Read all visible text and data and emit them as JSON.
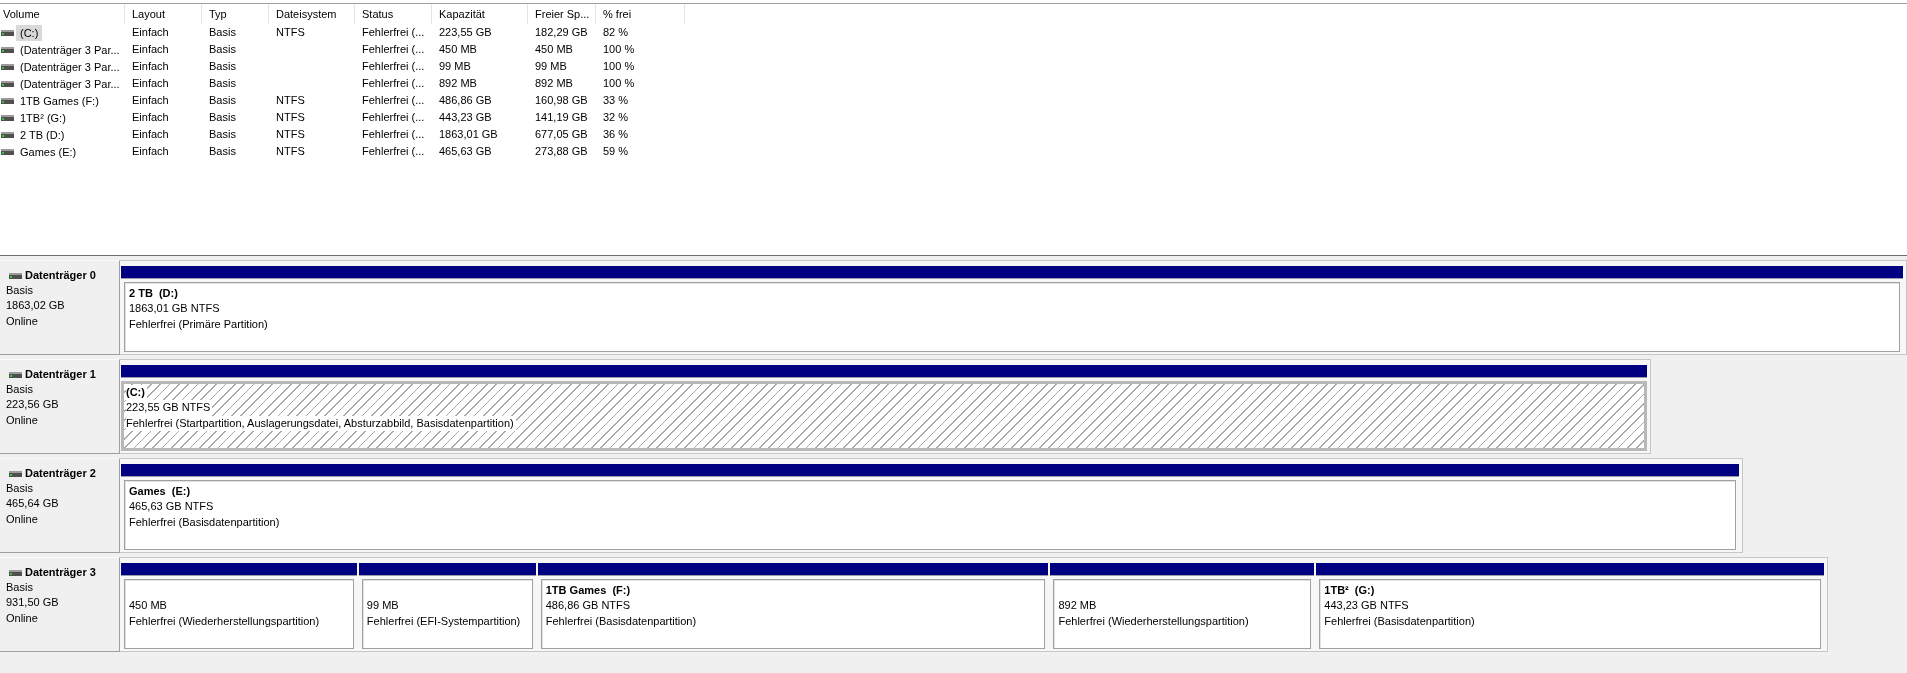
{
  "volume_table": {
    "columns": [
      "Volume",
      "Layout",
      "Typ",
      "Dateisystem",
      "Status",
      "Kapazität",
      "Freier Sp...",
      "% frei"
    ],
    "rows": [
      {
        "volume": "(C:)",
        "layout": "Einfach",
        "type": "Basis",
        "file_system": "NTFS",
        "status": "Fehlerfrei (...",
        "capacity": "223,55 GB",
        "free_space": "182,29 GB",
        "percent_free": "82 %",
        "selected": true
      },
      {
        "volume": "(Datenträger 3 Par...",
        "layout": "Einfach",
        "type": "Basis",
        "status": "Fehlerfrei (...",
        "capacity": "450 MB",
        "free_space": "450 MB",
        "percent_free": "100 %",
        "selected": false
      },
      {
        "volume": "(Datenträger 3 Par...",
        "layout": "Einfach",
        "type": "Basis",
        "status": "Fehlerfrei (...",
        "capacity": "99 MB",
        "free_space": "99 MB",
        "percent_free": "100 %",
        "selected": false
      },
      {
        "volume": "(Datenträger 3 Par...",
        "layout": "Einfach",
        "type": "Basis",
        "status": "Fehlerfrei (...",
        "capacity": "892 MB",
        "free_space": "892 MB",
        "percent_free": "100 %",
        "selected": false
      },
      {
        "volume": "1TB Games (F:)",
        "layout": "Einfach",
        "type": "Basis",
        "file_system": "NTFS",
        "status": "Fehlerfrei (...",
        "capacity": "486,86 GB",
        "free_space": "160,98 GB",
        "percent_free": "33 %",
        "selected": false
      },
      {
        "volume": "1TB² (G:)",
        "layout": "Einfach",
        "type": "Basis",
        "file_system": "NTFS",
        "status": "Fehlerfrei (...",
        "capacity": "443,23 GB",
        "free_space": "141,19 GB",
        "percent_free": "32 %",
        "selected": false
      },
      {
        "volume": "2 TB (D:)",
        "layout": "Einfach",
        "type": "Basis",
        "file_system": "NTFS",
        "status": "Fehlerfrei (...",
        "capacity": "1863,01 GB",
        "free_space": "677,05 GB",
        "percent_free": "36 %",
        "selected": false
      },
      {
        "volume": "Games (E:)",
        "layout": "Einfach",
        "type": "Basis",
        "file_system": "NTFS",
        "status": "Fehlerfrei (...",
        "capacity": "465,63 GB",
        "free_space": "273,88 GB",
        "percent_free": "59 %",
        "selected": false
      }
    ]
  },
  "disks": [
    {
      "name": "Datenträger 0",
      "type": "Basis",
      "size": "1863,02 GB",
      "state": "Online",
      "partitions": [
        {
          "name": "2 TB  (D:)",
          "size": "1863,01 GB NTFS",
          "status": "Fehlerfrei (Primäre Partition)",
          "selected": false
        }
      ]
    },
    {
      "name": "Datenträger 1",
      "type": "Basis",
      "size": "223,56 GB",
      "state": "Online",
      "partitions": [
        {
          "name": "(C:)",
          "size": "223,55 GB NTFS",
          "status": "Fehlerfrei (Startpartition, Auslagerungsdatei, Absturzabbild, Basisdatenpartition)",
          "selected": true
        }
      ]
    },
    {
      "name": "Datenträger 2",
      "type": "Basis",
      "size": "465,64 GB",
      "state": "Online",
      "partitions": [
        {
          "name": "Games  (E:)",
          "size": "465,63 GB NTFS",
          "status": "Fehlerfrei (Basisdatenpartition)",
          "selected": false
        }
      ]
    },
    {
      "name": "Datenträger 3",
      "type": "Basis",
      "size": "931,50 GB",
      "state": "Online",
      "partitions": [
        {
          "size": "450 MB",
          "status": "Fehlerfrei (Wiederherstellungspartition)",
          "selected": false
        },
        {
          "size": "99 MB",
          "status": "Fehlerfrei (EFI-Systempartition)",
          "selected": false
        },
        {
          "name": "1TB Games  (F:)",
          "size": "486,86 GB NTFS",
          "status": "Fehlerfrei (Basisdatenpartition)",
          "selected": false
        },
        {
          "size": "892 MB",
          "status": "Fehlerfrei (Wiederherstellungspartition)",
          "selected": false
        },
        {
          "name": "1TB²  (G:)",
          "size": "443,23 GB NTFS",
          "status": "Fehlerfrei (Basisdatenpartition)",
          "selected": false
        }
      ]
    }
  ]
}
